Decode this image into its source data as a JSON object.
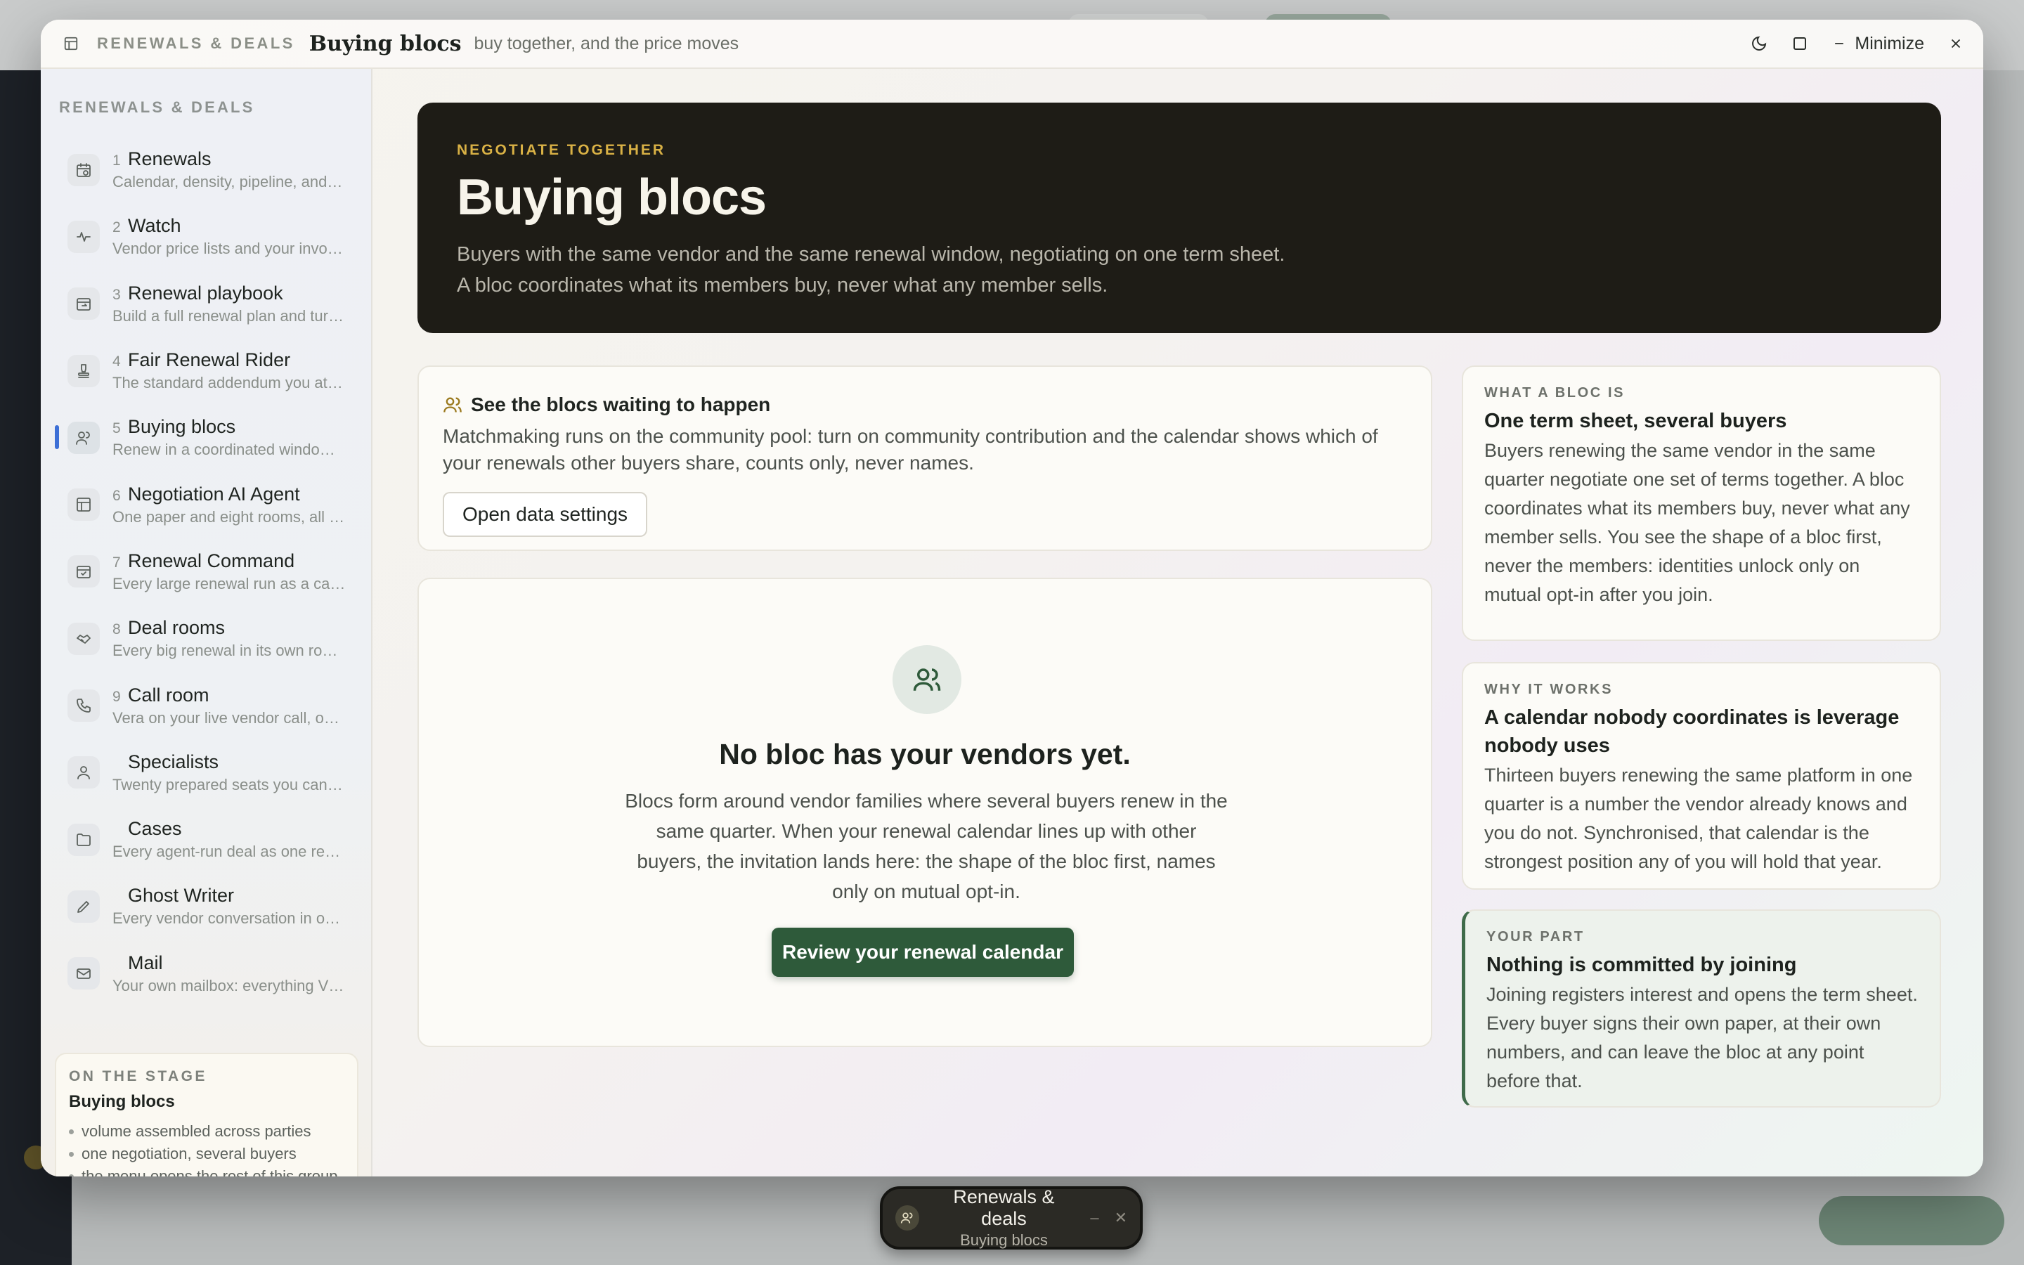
{
  "titlebar": {
    "group": "RENEWALS & DEALS",
    "title": "Buying blocs",
    "subtitle": "buy together, and the price moves",
    "minimize_label": "Minimize"
  },
  "sidebar": {
    "heading": "RENEWALS & DEALS",
    "items": [
      {
        "num": "1",
        "label": "Renewals",
        "desc": "Calendar, density, pipeline, and…",
        "icon": "calendar-clock-icon"
      },
      {
        "num": "2",
        "label": "Watch",
        "desc": "Vendor price lists and your invo…",
        "icon": "pulse-icon"
      },
      {
        "num": "3",
        "label": "Renewal playbook",
        "desc": "Build a full renewal plan and tur…",
        "icon": "calendar-arrow-icon"
      },
      {
        "num": "4",
        "label": "Fair Renewal Rider",
        "desc": "The standard addendum you at…",
        "icon": "stamp-icon"
      },
      {
        "num": "5",
        "label": "Buying blocs",
        "desc": "Renew in a coordinated windo…",
        "icon": "users-icon",
        "active": true
      },
      {
        "num": "6",
        "label": "Negotiation AI Agent",
        "desc": "One paper and eight rooms, all …",
        "icon": "layout-icon"
      },
      {
        "num": "7",
        "label": "Renewal Command",
        "desc": "Every large renewal run as a ca…",
        "icon": "calendar-check-icon"
      },
      {
        "num": "8",
        "label": "Deal rooms",
        "desc": "Every big renewal in its own ro…",
        "icon": "handshake-icon"
      },
      {
        "num": "9",
        "label": "Call room",
        "desc": "Vera on your live vendor call, o…",
        "icon": "phone-icon"
      },
      {
        "num": "",
        "label": "Specialists",
        "desc": "Twenty prepared seats you can…",
        "icon": "user-icon"
      },
      {
        "num": "",
        "label": "Cases",
        "desc": "Every agent-run deal as one re…",
        "icon": "folder-icon"
      },
      {
        "num": "",
        "label": "Ghost Writer",
        "desc": "Every vendor conversation in o…",
        "icon": "pen-icon"
      },
      {
        "num": "",
        "label": "Mail",
        "desc": "Your own mailbox: everything V…",
        "icon": "mail-icon"
      }
    ],
    "stage": {
      "heading": "ON THE STAGE",
      "title": "Buying blocs",
      "points": [
        "volume assembled across parties",
        "one negotiation, several buyers",
        "the menu opens the rest of this group"
      ]
    }
  },
  "hero": {
    "eyebrow": "NEGOTIATE TOGETHER",
    "title": "Buying blocs",
    "line1": "Buyers with the same vendor and the same renewal window, negotiating on one term sheet.",
    "line2": "A bloc coordinates what its members buy, never what any member sells."
  },
  "waiting": {
    "title": "See the blocs waiting to happen",
    "body": "Matchmaking runs on the community pool: turn on community contribution and the calendar shows which of your renewals other buyers share, counts only, never names.",
    "button": "Open data settings"
  },
  "empty": {
    "title": "No bloc has your vendors yet.",
    "body": "Blocs form around vendor families where several buyers renew in the same quarter. When your renewal calendar lines up with other buyers, the invitation lands here: the shape of the bloc first, names only on mutual opt-in.",
    "button": "Review your renewal calendar"
  },
  "cards": [
    {
      "eyebrow": "WHAT A BLOC IS",
      "title": "One term sheet, several buyers",
      "body": "Buyers renewing the same vendor in the same quarter negotiate one set of terms together. A bloc coordinates what its members buy, never what any member sells. You see the shape of a bloc first, never the members: identities unlock only on mutual opt-in after you join."
    },
    {
      "eyebrow": "WHY IT WORKS",
      "title": "A calendar nobody coordinates is leverage nobody uses",
      "body": "Thirteen buyers renewing the same platform in one quarter is a number the vendor already knows and you do not. Synchronised, that calendar is the strongest position any of you will hold that year."
    },
    {
      "eyebrow": "YOUR PART",
      "title": "Nothing is committed by joining",
      "body": "Joining registers interest and opens the term sheet. Every buyer signs their own paper, at their own numbers, and can leave the bloc at any point before that."
    }
  ],
  "dock": {
    "title": "Renewals & deals",
    "subtitle": "Buying blocs"
  },
  "colors": {
    "accent_green": "#2e5a3a",
    "hero_bg": "#1e1c16",
    "eyebrow_gold": "#d9b145",
    "active_marker": "#3c6fd6"
  }
}
